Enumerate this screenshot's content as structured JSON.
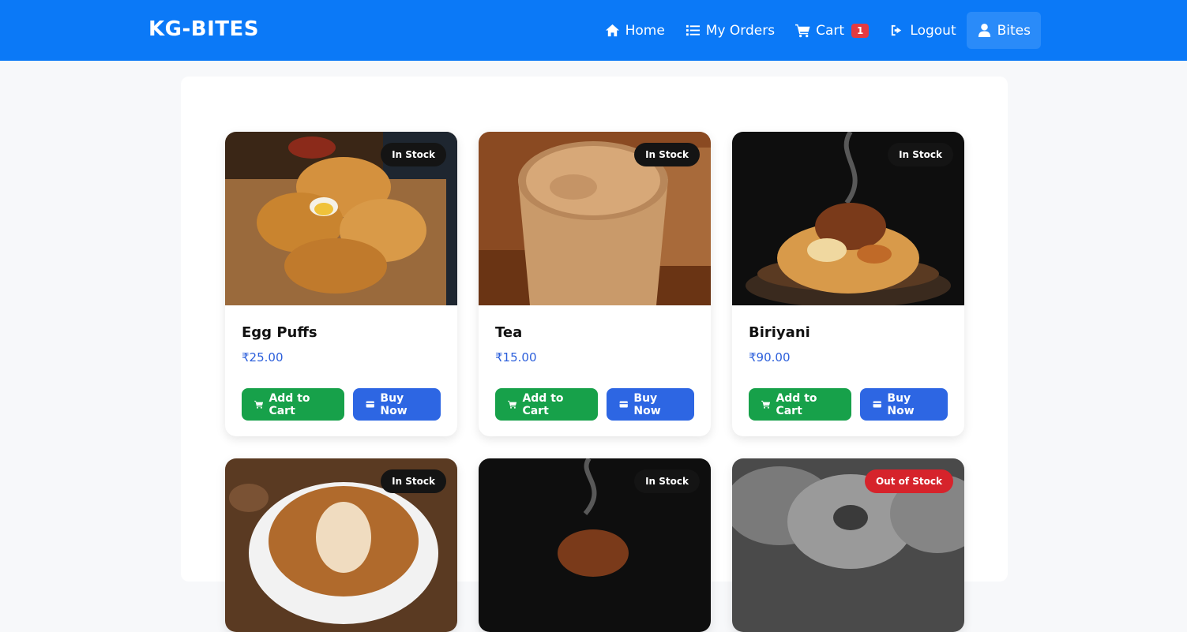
{
  "brand": "KG-BITES",
  "nav": {
    "home": "Home",
    "orders": "My Orders",
    "cart": "Cart",
    "cart_count": "1",
    "logout": "Logout",
    "user": "Bites"
  },
  "products": [
    {
      "name": "Egg Puffs",
      "price": "₹25.00",
      "status": "In Stock",
      "add": "Add to Cart",
      "buy": "Buy Now"
    },
    {
      "name": "Tea",
      "price": "₹15.00",
      "status": "In Stock",
      "add": "Add to Cart",
      "buy": "Buy Now"
    },
    {
      "name": "Biriyani",
      "price": "₹90.00",
      "status": "In Stock",
      "add": "Add to Cart",
      "buy": "Buy Now"
    },
    {
      "status": "In Stock"
    },
    {
      "status": "In Stock"
    },
    {
      "status": "Out of Stock"
    }
  ],
  "colors": {
    "navbar": "#0b79f7",
    "add_button": "#17a14a",
    "buy_button": "#2d66e3",
    "out_of_stock": "#d6232b"
  }
}
